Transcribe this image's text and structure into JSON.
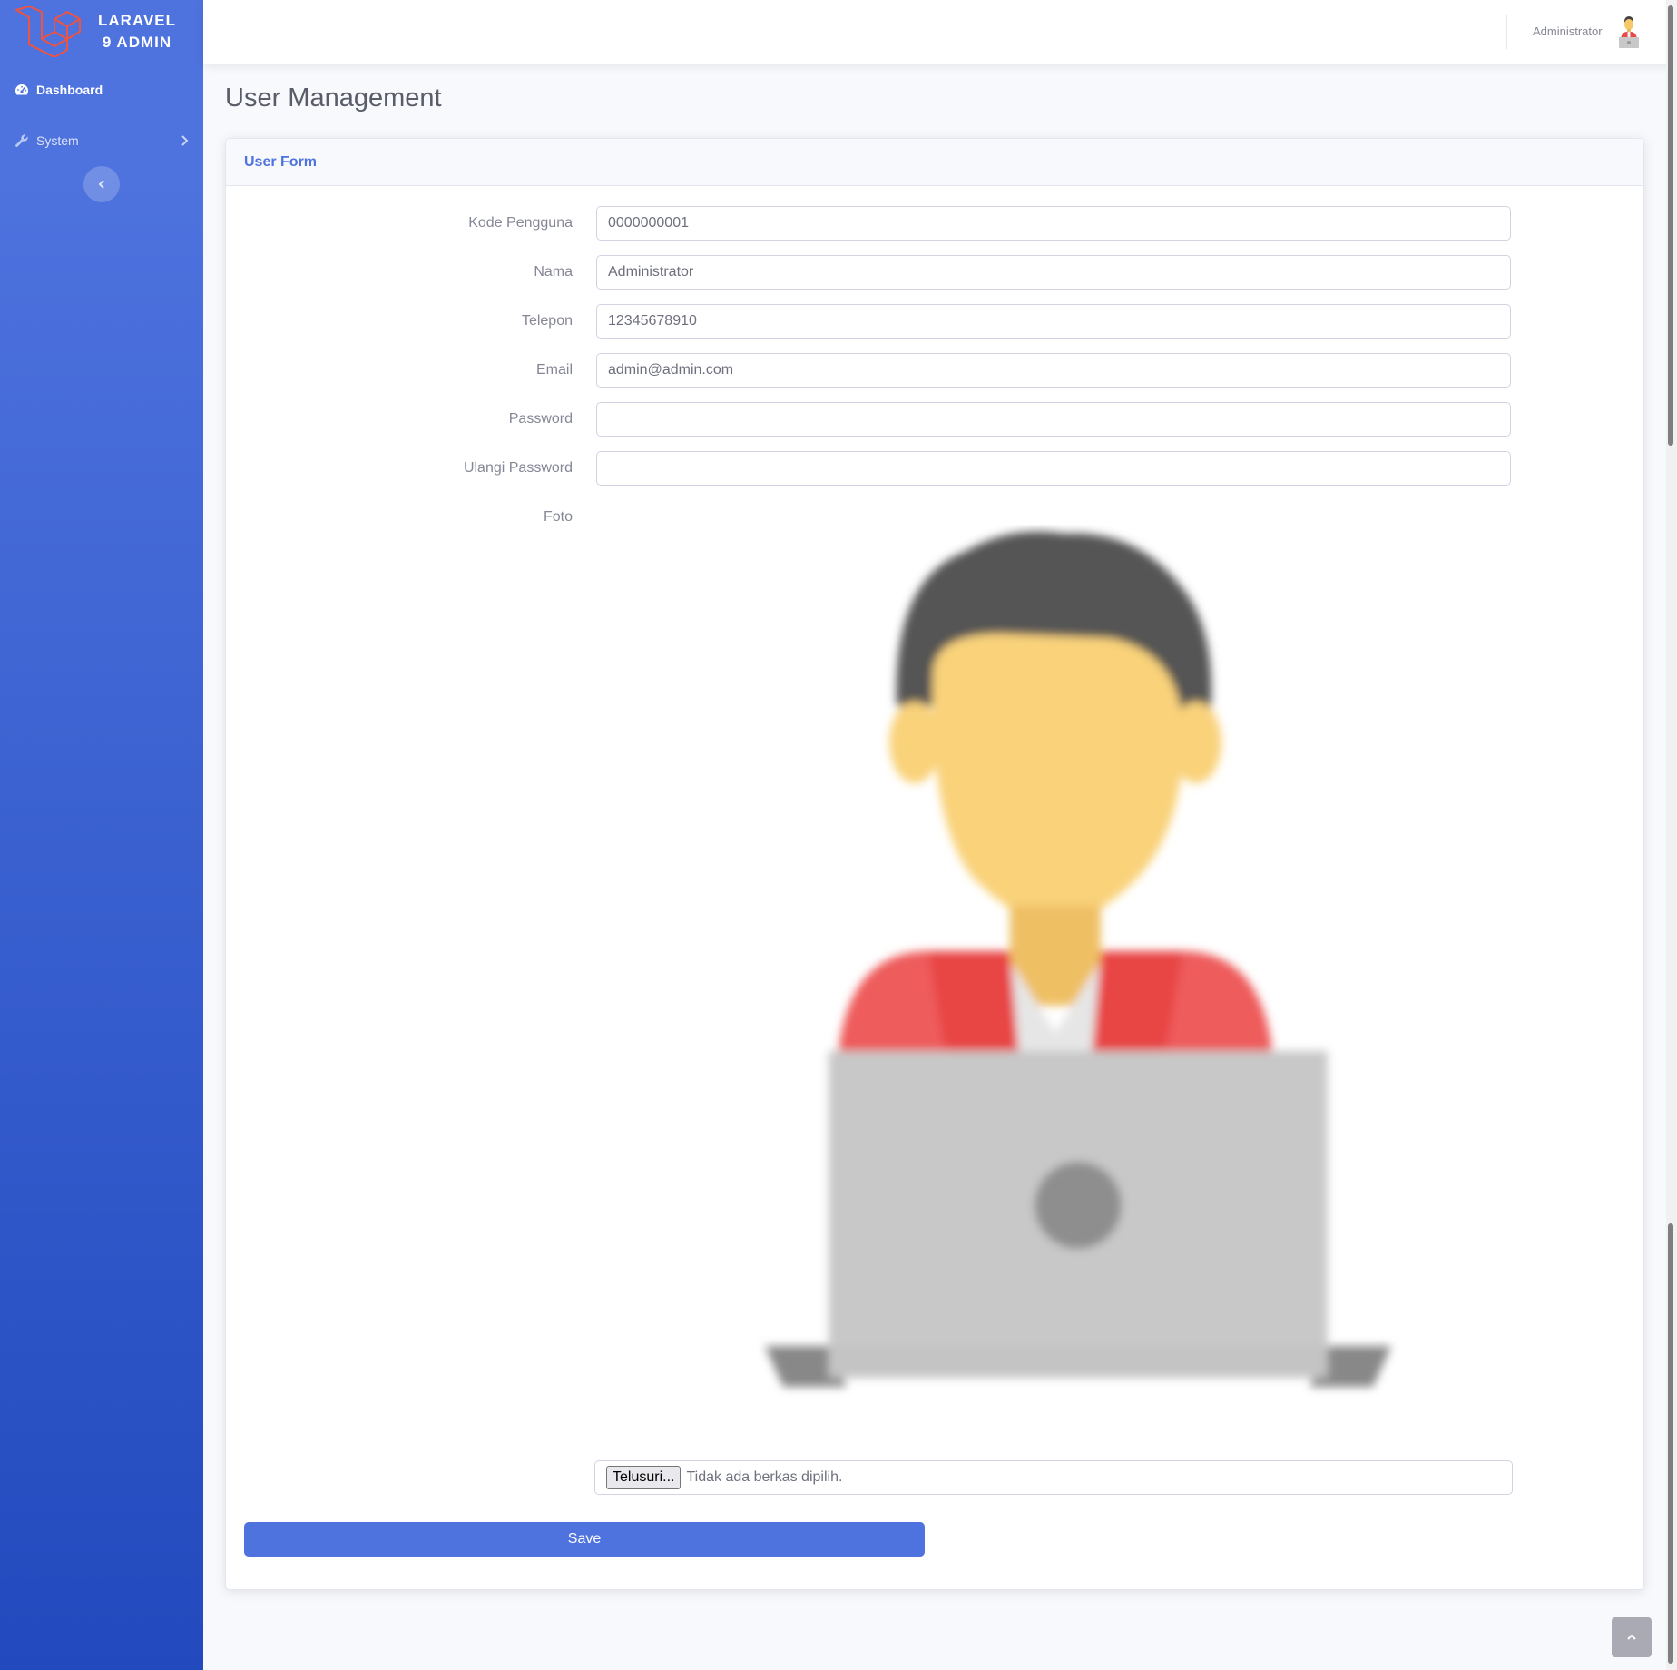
{
  "sidebar": {
    "brand_line1": "LARAVEL",
    "brand_line2": "9 ADMIN",
    "items": [
      {
        "label": "Dashboard",
        "icon": "tachometer-icon",
        "active": true
      },
      {
        "label": "System",
        "icon": "wrench-icon",
        "active": false
      }
    ],
    "toggle_icon": "chevron-left-icon"
  },
  "topbar": {
    "user_name": "Administrator"
  },
  "page": {
    "title": "User Management"
  },
  "card": {
    "header": "User Form",
    "fields": [
      {
        "label": "Kode Pengguna",
        "value": "0000000001"
      },
      {
        "label": "Nama",
        "value": "Administrator"
      },
      {
        "label": "Telepon",
        "value": "12345678910"
      },
      {
        "label": "Email",
        "value": "admin@admin.com"
      },
      {
        "label": "Password",
        "value": ""
      },
      {
        "label": "Ulangi Password",
        "value": ""
      }
    ],
    "photo_label": "Foto",
    "file_browse_label": "Telusuri...",
    "file_status": "Tidak ada berkas dipilih.",
    "save_label": "Save"
  },
  "colors": {
    "primary": "#4e73df",
    "sidebar_gradient_end": "#224abe",
    "laravel_red": "#f05340"
  }
}
